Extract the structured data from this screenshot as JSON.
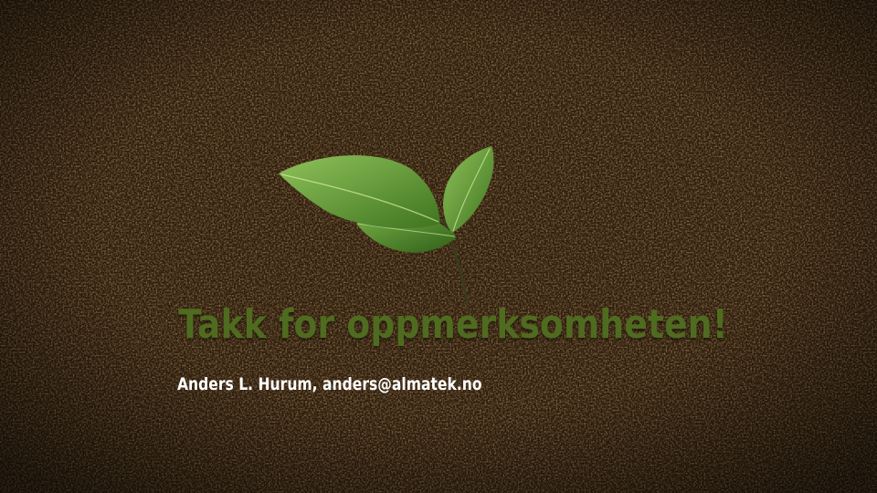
{
  "slide": {
    "title": "Takk for oppmerksomheten!",
    "author_line": "Anders L. Hurum, anders@almatek.no"
  },
  "colors": {
    "background": "#2c1b0d",
    "title": "#4f6b1f",
    "author": "#ffffff",
    "leaf": "#5a8f2a"
  },
  "icons": {
    "sprout": "sprout-icon"
  }
}
